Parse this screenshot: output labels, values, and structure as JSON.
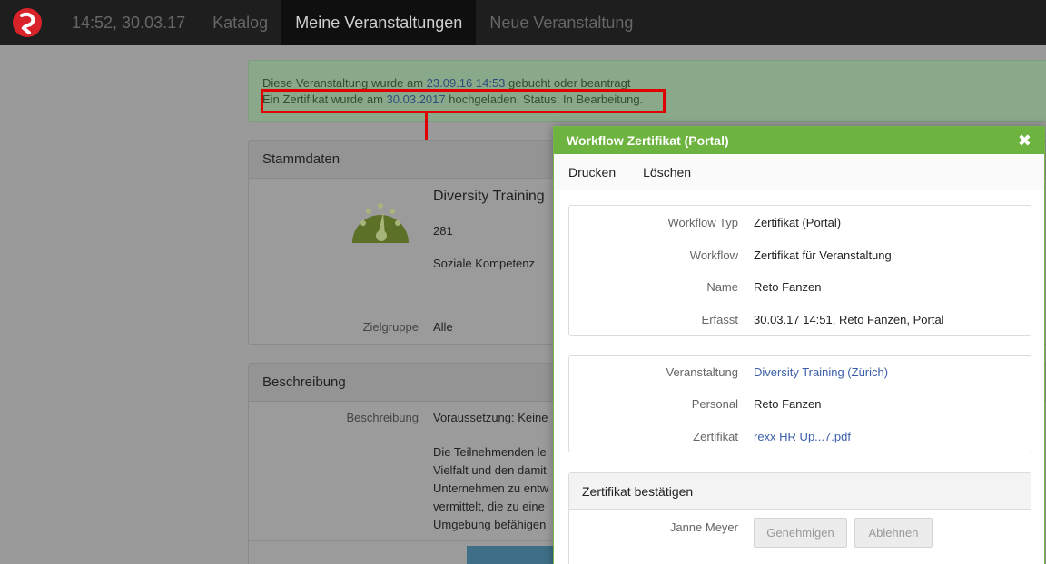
{
  "topbar": {
    "datetime": "14:52, 30.03.17",
    "nav": [
      "Katalog",
      "Meine Veranstaltungen",
      "Neue Veranstaltung"
    ]
  },
  "alert": {
    "line1_pre": "Diese Veranstaltung wurde am ",
    "line1_link": "23.09.16 14:53",
    "line1_post": " gebucht oder beantragt",
    "line2_pre": "Ein Zertifikat wurde am ",
    "line2_link": "30.03.2017",
    "line2_post": " hochgeladen. Status: In Bearbeitung."
  },
  "stammdaten": {
    "heading": "Stammdaten",
    "title": "Diversity Training",
    "number": "281",
    "category": "Soziale Kompetenz",
    "zielgruppe_label": "Zielgruppe",
    "zielgruppe_value": "Alle"
  },
  "beschreibung": {
    "heading": "Beschreibung",
    "label": "Beschreibung",
    "lines": [
      "Voraussetzung: Keine",
      "Die Teilnehmenden le",
      "Vielfalt und den damit",
      "Unternehmen zu entw",
      "vermittelt, die zu eine",
      "Umgebung befähigen"
    ]
  },
  "dialog": {
    "title": "Workflow Zertifikat (Portal)",
    "toolbar": {
      "print": "Drucken",
      "delete": "Löschen"
    },
    "card1": [
      {
        "label": "Workflow Typ",
        "value": "Zertifikat (Portal)"
      },
      {
        "label": "Workflow",
        "value": "Zertifikat für Veranstaltung"
      },
      {
        "label": "Name",
        "value": "Reto Fanzen"
      },
      {
        "label": "Erfasst",
        "value": "30.03.17 14:51, Reto Fanzen, Portal"
      }
    ],
    "card2": [
      {
        "label": "Veranstaltung",
        "value": "Diversity Training (Zürich)"
      },
      {
        "label": "Personal",
        "value": "Reto Fanzen"
      },
      {
        "label": "Zertifikat",
        "value": "rexx HR Up...7.pdf"
      }
    ],
    "card3": {
      "heading": "Zertifikat bestätigen",
      "person": "Janne Meyer",
      "approve": "Genehmigen",
      "reject": "Ablehnen"
    }
  },
  "colors": {
    "dialog_header": "#6db33f",
    "highlight": "#e00000",
    "link": "#3a5ea8"
  }
}
